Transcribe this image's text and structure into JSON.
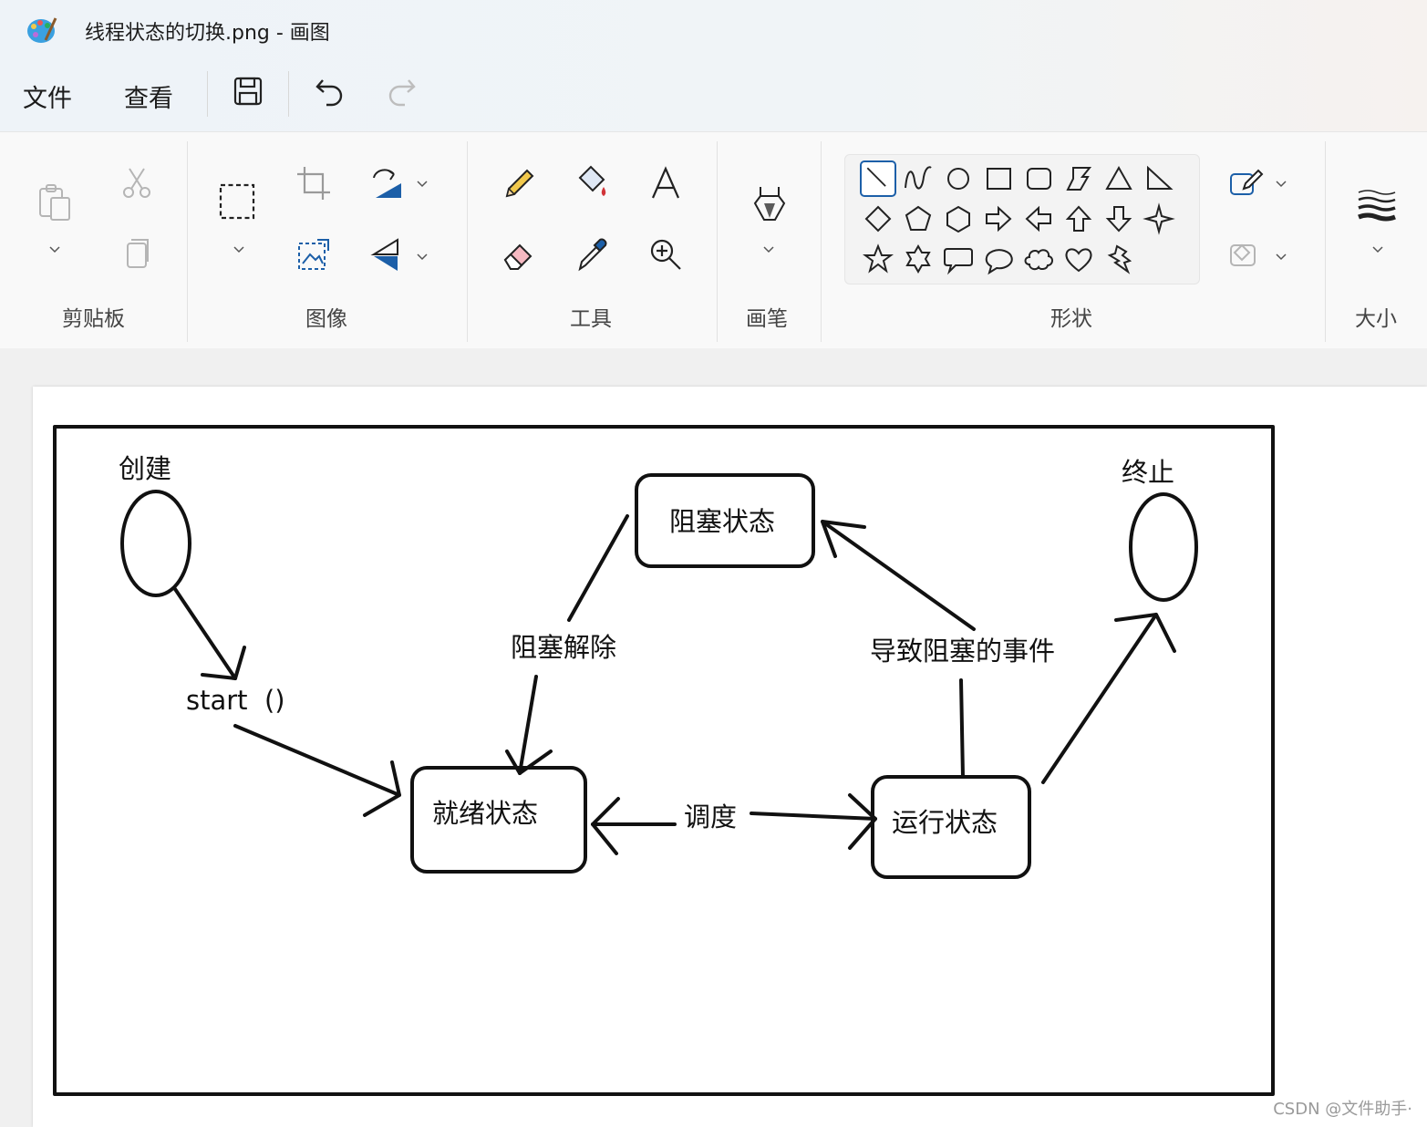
{
  "window": {
    "title": "线程状态的切换.png - 画图"
  },
  "menu": {
    "file": "文件",
    "view": "查看"
  },
  "ribbon": {
    "groups": {
      "clipboard": "剪贴板",
      "image": "图像",
      "tools": "工具",
      "brushes": "画笔",
      "shapes": "形状",
      "size": "大小"
    }
  },
  "diagram": {
    "create": "创建",
    "terminate": "终止",
    "blocked": "阻塞状态",
    "unblock": "阻塞解除",
    "block_event": "导致阻塞的事件",
    "start": "start  ()",
    "ready": "就绪状态",
    "schedule": "调度",
    "running": "运行状态"
  },
  "watermark": "CSDN @文件助手·",
  "colors": {
    "accent": "#1c5fa8",
    "ink": "#111111"
  }
}
